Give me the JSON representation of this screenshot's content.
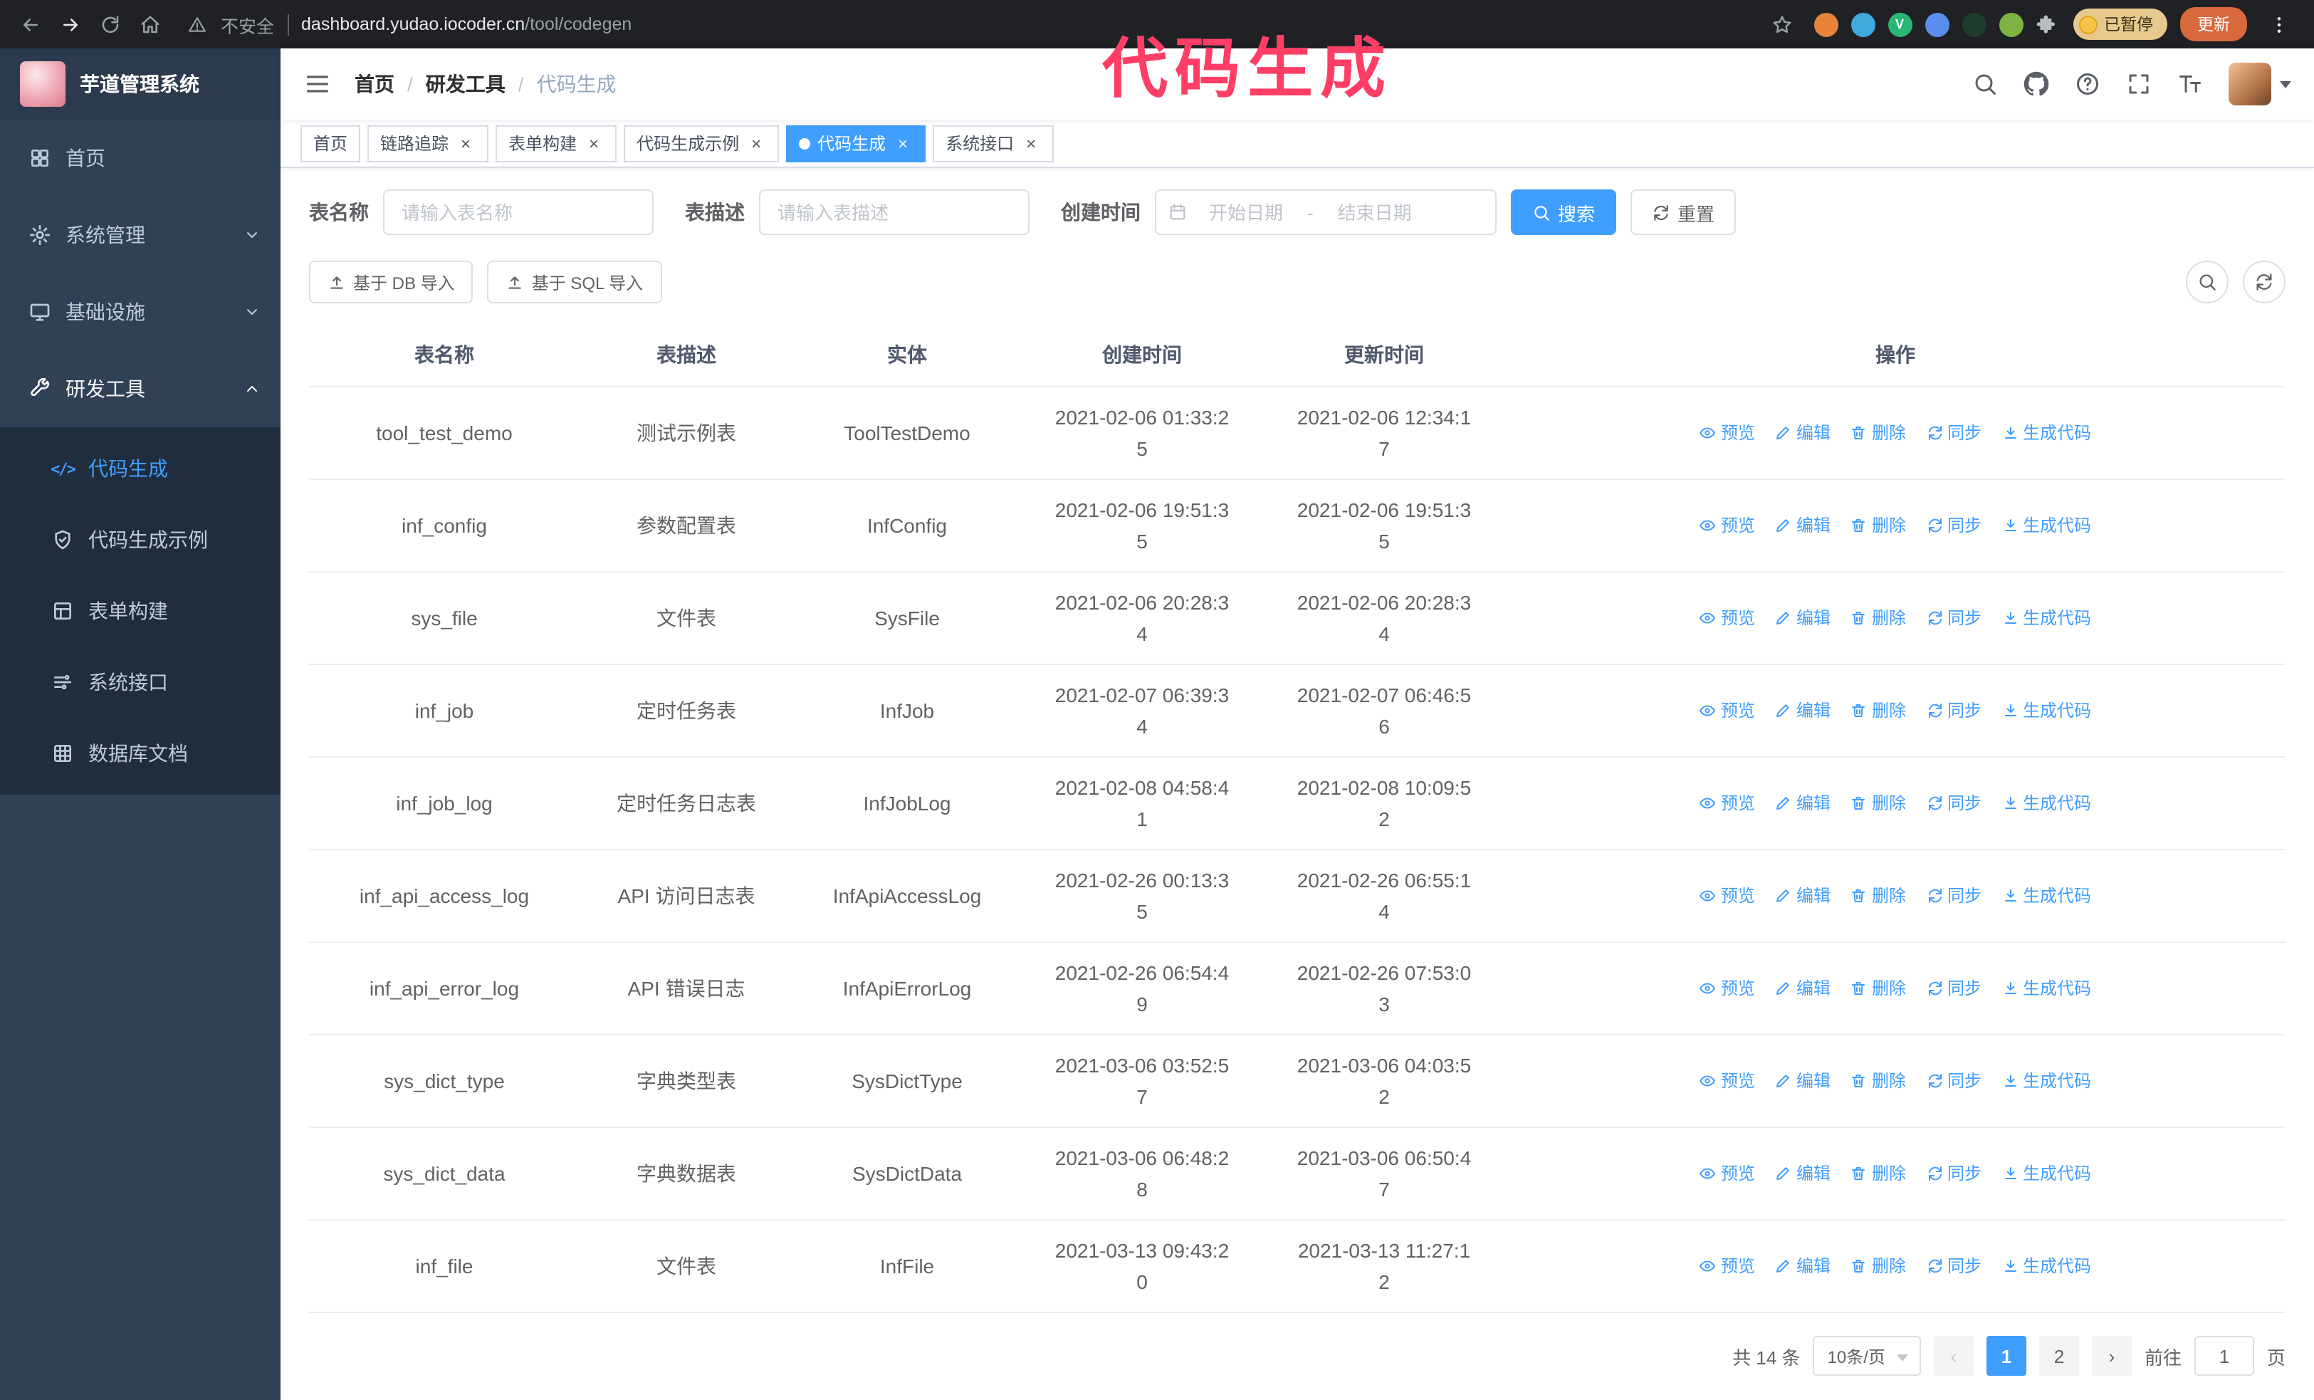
{
  "colors": {
    "accent": "#409eff",
    "annotation": "#ff3e66",
    "sidebar_bg": "#304156",
    "submenu_bg": "#1f2d3d"
  },
  "browser": {
    "security_label": "不安全",
    "url_host": "dashboard.yudao.iocoder.cn",
    "url_path": "/tool/codegen",
    "paused_badge": "已暂停",
    "update_button": "更新"
  },
  "annotation": {
    "text": "代码生成"
  },
  "sidebar": {
    "logo_title": "芋道管理系统",
    "menu": [
      {
        "id": "home",
        "label": "首页",
        "icon": "dashboard-icon"
      },
      {
        "id": "system",
        "label": "系统管理",
        "icon": "gear-icon",
        "arrow": "down"
      },
      {
        "id": "infra",
        "label": "基础设施",
        "icon": "monitor-icon",
        "arrow": "down"
      },
      {
        "id": "dev-tools",
        "label": "研发工具",
        "icon": "wrench-icon",
        "arrow": "up",
        "expanded": true,
        "children": [
          {
            "id": "codegen",
            "label": "代码生成",
            "icon": "code-icon",
            "active": true
          },
          {
            "id": "codegen-example",
            "label": "代码生成示例",
            "icon": "shield-icon"
          },
          {
            "id": "form-builder",
            "label": "表单构建",
            "icon": "form-icon"
          },
          {
            "id": "system-api",
            "label": "系统接口",
            "icon": "api-icon"
          },
          {
            "id": "db-doc",
            "label": "数据库文档",
            "icon": "database-icon"
          }
        ]
      }
    ]
  },
  "header": {
    "breadcrumb": [
      "首页",
      "研发工具",
      "代码生成"
    ]
  },
  "tabs": [
    {
      "id": "home",
      "label": "首页",
      "closable": false,
      "active": false
    },
    {
      "id": "tracer",
      "label": "链路追踪",
      "closable": true,
      "active": false
    },
    {
      "id": "form-builder",
      "label": "表单构建",
      "closable": true,
      "active": false
    },
    {
      "id": "codegen-example",
      "label": "代码生成示例",
      "closable": true,
      "active": false
    },
    {
      "id": "codegen",
      "label": "代码生成",
      "closable": true,
      "active": true
    },
    {
      "id": "system-api",
      "label": "系统接口",
      "closable": true,
      "active": false
    }
  ],
  "filters": {
    "table_name_label": "表名称",
    "table_name_placeholder": "请输入表名称",
    "table_desc_label": "表描述",
    "table_desc_placeholder": "请输入表描述",
    "create_time_label": "创建时间",
    "date_start_placeholder": "开始日期",
    "date_separator": "-",
    "date_end_placeholder": "结束日期",
    "search_button": "搜索",
    "reset_button": "重置"
  },
  "toolbar": {
    "import_db": "基于 DB 导入",
    "import_sql": "基于 SQL 导入"
  },
  "table": {
    "columns": [
      "表名称",
      "表描述",
      "实体",
      "创建时间",
      "更新时间",
      "操作"
    ],
    "ops": [
      {
        "id": "preview",
        "label": "预览",
        "icon": "eye-icon"
      },
      {
        "id": "edit",
        "label": "编辑",
        "icon": "edit-icon"
      },
      {
        "id": "delete",
        "label": "删除",
        "icon": "delete-icon"
      },
      {
        "id": "sync",
        "label": "同步",
        "icon": "sync-icon"
      },
      {
        "id": "generate",
        "label": "生成代码",
        "icon": "download-icon"
      }
    ],
    "rows": [
      {
        "name": "tool_test_demo",
        "desc": "测试示例表",
        "entity": "ToolTestDemo",
        "created": "2021-02-06 01:33:25",
        "updated": "2021-02-06 12:34:17"
      },
      {
        "name": "inf_config",
        "desc": "参数配置表",
        "entity": "InfConfig",
        "created": "2021-02-06 19:51:35",
        "updated": "2021-02-06 19:51:35"
      },
      {
        "name": "sys_file",
        "desc": "文件表",
        "entity": "SysFile",
        "created": "2021-02-06 20:28:34",
        "updated": "2021-02-06 20:28:34"
      },
      {
        "name": "inf_job",
        "desc": "定时任务表",
        "entity": "InfJob",
        "created": "2021-02-07 06:39:34",
        "updated": "2021-02-07 06:46:56"
      },
      {
        "name": "inf_job_log",
        "desc": "定时任务日志表",
        "entity": "InfJobLog",
        "created": "2021-02-08 04:58:41",
        "updated": "2021-02-08 10:09:52"
      },
      {
        "name": "inf_api_access_log",
        "desc": "API 访问日志表",
        "entity": "InfApiAccessLog",
        "created": "2021-02-26 00:13:35",
        "updated": "2021-02-26 06:55:14"
      },
      {
        "name": "inf_api_error_log",
        "desc": "API 错误日志",
        "entity": "InfApiErrorLog",
        "created": "2021-02-26 06:54:49",
        "updated": "2021-02-26 07:53:03"
      },
      {
        "name": "sys_dict_type",
        "desc": "字典类型表",
        "entity": "SysDictType",
        "created": "2021-03-06 03:52:57",
        "updated": "2021-03-06 04:03:52"
      },
      {
        "name": "sys_dict_data",
        "desc": "字典数据表",
        "entity": "SysDictData",
        "created": "2021-03-06 06:48:28",
        "updated": "2021-03-06 06:50:47"
      },
      {
        "name": "inf_file",
        "desc": "文件表",
        "entity": "InfFile",
        "created": "2021-03-13 09:43:20",
        "updated": "2021-03-13 11:27:12"
      }
    ]
  },
  "pagination": {
    "total_text": "共 14 条",
    "page_size": "10条/页",
    "pages": [
      "1",
      "2"
    ],
    "active_page": "1",
    "goto_label": "前往",
    "goto_value": "1",
    "goto_suffix": "页"
  }
}
